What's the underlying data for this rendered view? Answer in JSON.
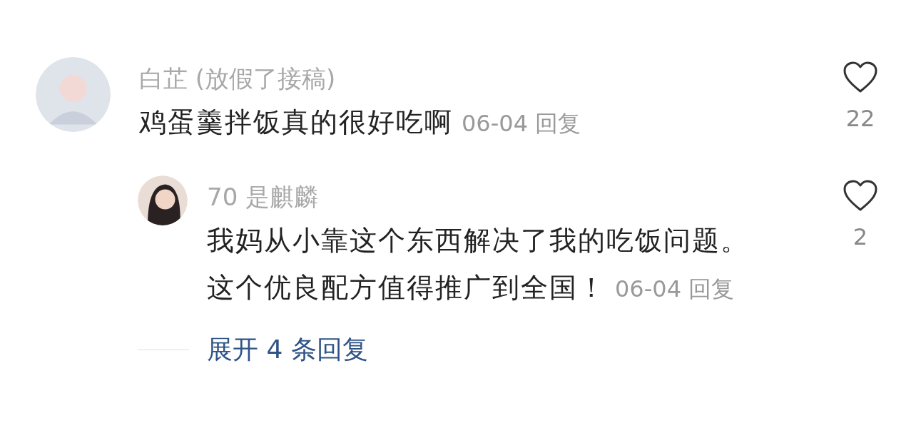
{
  "comments": [
    {
      "author": "白芷 (放假了接稿)",
      "lines": [
        "鸡蛋羹拌饭真的很好吃啊"
      ],
      "date": "06-04",
      "reply_label": "回复",
      "likes": "22",
      "replies": [
        {
          "author": "70 是麒麟",
          "lines": [
            "我妈从小靠这个东西解决了我的吃饭问题。",
            "这个优良配方值得推广到全国！"
          ],
          "date": "06-04",
          "reply_label": "回复",
          "likes": "2"
        }
      ],
      "expand_label": "展开 4 条回复"
    }
  ]
}
